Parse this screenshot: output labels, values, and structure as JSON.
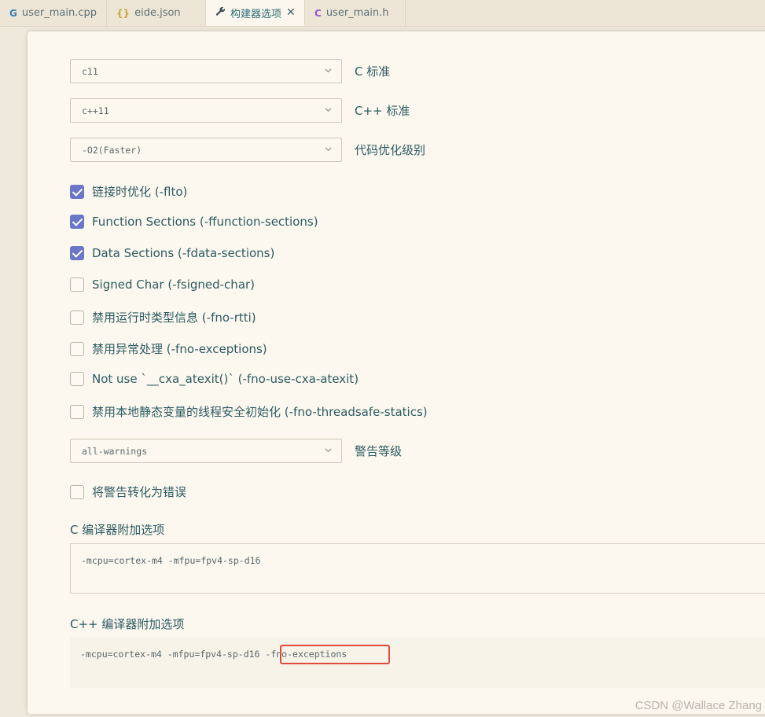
{
  "tabs": [
    {
      "label": "user_main.cpp",
      "icon": "cpp-file-icon"
    },
    {
      "label": "eide.json",
      "icon": "json-file-icon"
    },
    {
      "label": "构建器选项",
      "icon": "wrench-icon",
      "active": true
    },
    {
      "label": "user_main.h",
      "icon": "c-file-icon"
    }
  ],
  "options": {
    "c_standard": {
      "value": "c11",
      "label": "C 标准"
    },
    "cpp_standard": {
      "value": "c++11",
      "label": "C++ 标准"
    },
    "optimization": {
      "value": "-O2(Faster)",
      "label": "代码优化级别"
    },
    "checkboxes": [
      {
        "label": "链接时优化 (-flto)",
        "checked": true
      },
      {
        "label": "Function Sections (-ffunction-sections)",
        "checked": true
      },
      {
        "label": "Data Sections (-fdata-sections)",
        "checked": true
      },
      {
        "label": "Signed Char (-fsigned-char)",
        "checked": false
      },
      {
        "label": "禁用运行时类型信息 (-fno-rtti)",
        "checked": false
      },
      {
        "label": "禁用异常处理 (-fno-exceptions)",
        "checked": false
      },
      {
        "label": "Not use `__cxa_atexit()` (-fno-use-cxa-atexit)",
        "checked": false
      },
      {
        "label": "禁用本地静态变量的线程安全初始化 (-fno-threadsafe-statics)",
        "checked": false
      }
    ],
    "warnings": {
      "value": "all-warnings",
      "label": "警告等级"
    },
    "warnings_as_errors": {
      "label": "将警告转化为错误",
      "checked": false
    },
    "c_extra": {
      "label": "C 编译器附加选项",
      "value": "-mcpu=cortex-m4 -mfpu=fpv4-sp-d16"
    },
    "cpp_extra": {
      "label": "C++ 编译器附加选项",
      "value": "-mcpu=cortex-m4 -mfpu=fpv4-sp-d16 -fno-exceptions"
    }
  },
  "watermark": "CSDN @Wallace Zhang",
  "colors": {
    "checkbox_checked": "#6a76c8",
    "highlight_box": "#e14a3b",
    "text": "#2c5b62"
  }
}
